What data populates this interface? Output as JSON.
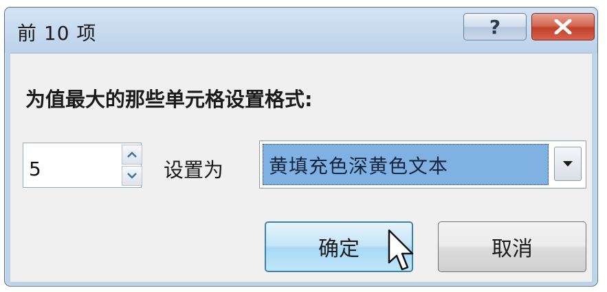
{
  "window": {
    "title": "前 10 项"
  },
  "caption_buttons": {
    "help_label": "?"
  },
  "prompt": "为值最大的那些单元格设置格式:",
  "spinner": {
    "value": "5"
  },
  "set_as_label": "设置为",
  "format_combo": {
    "selected": "黄填充色深黄色文本"
  },
  "buttons": {
    "ok": "确定",
    "cancel": "取消"
  },
  "colors": {
    "title_bar": "#bcd2ea",
    "close_button": "#c94a36",
    "combo_selection": "#7fb1e3",
    "ok_button": "#b3def6"
  }
}
